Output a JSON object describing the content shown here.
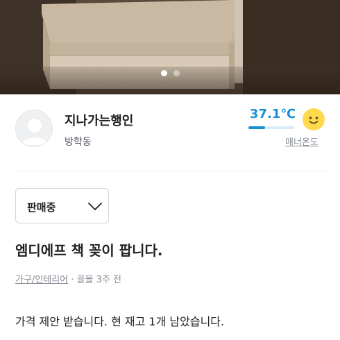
{
  "photo": {
    "dots": [
      {
        "active": true
      },
      {
        "active": false
      }
    ]
  },
  "seller": {
    "nickname": "지나가는행인",
    "region": "방학동",
    "temperature": "37.1℃",
    "temperature_level": 0.37,
    "manner_label": "매너온도"
  },
  "status": {
    "label": "판매중",
    "icon": "chevron-down-icon"
  },
  "post": {
    "title": "엠디에프 책 꽂이 팝니다.",
    "category": "가구/인테리어",
    "separator": " · ",
    "time": "끌올 3주 전",
    "description": "가격 제안 받습니다. 현 재고 1개 남았습니다."
  },
  "colors": {
    "temperature": "#1c8fd6",
    "face": "#ffd84c"
  }
}
